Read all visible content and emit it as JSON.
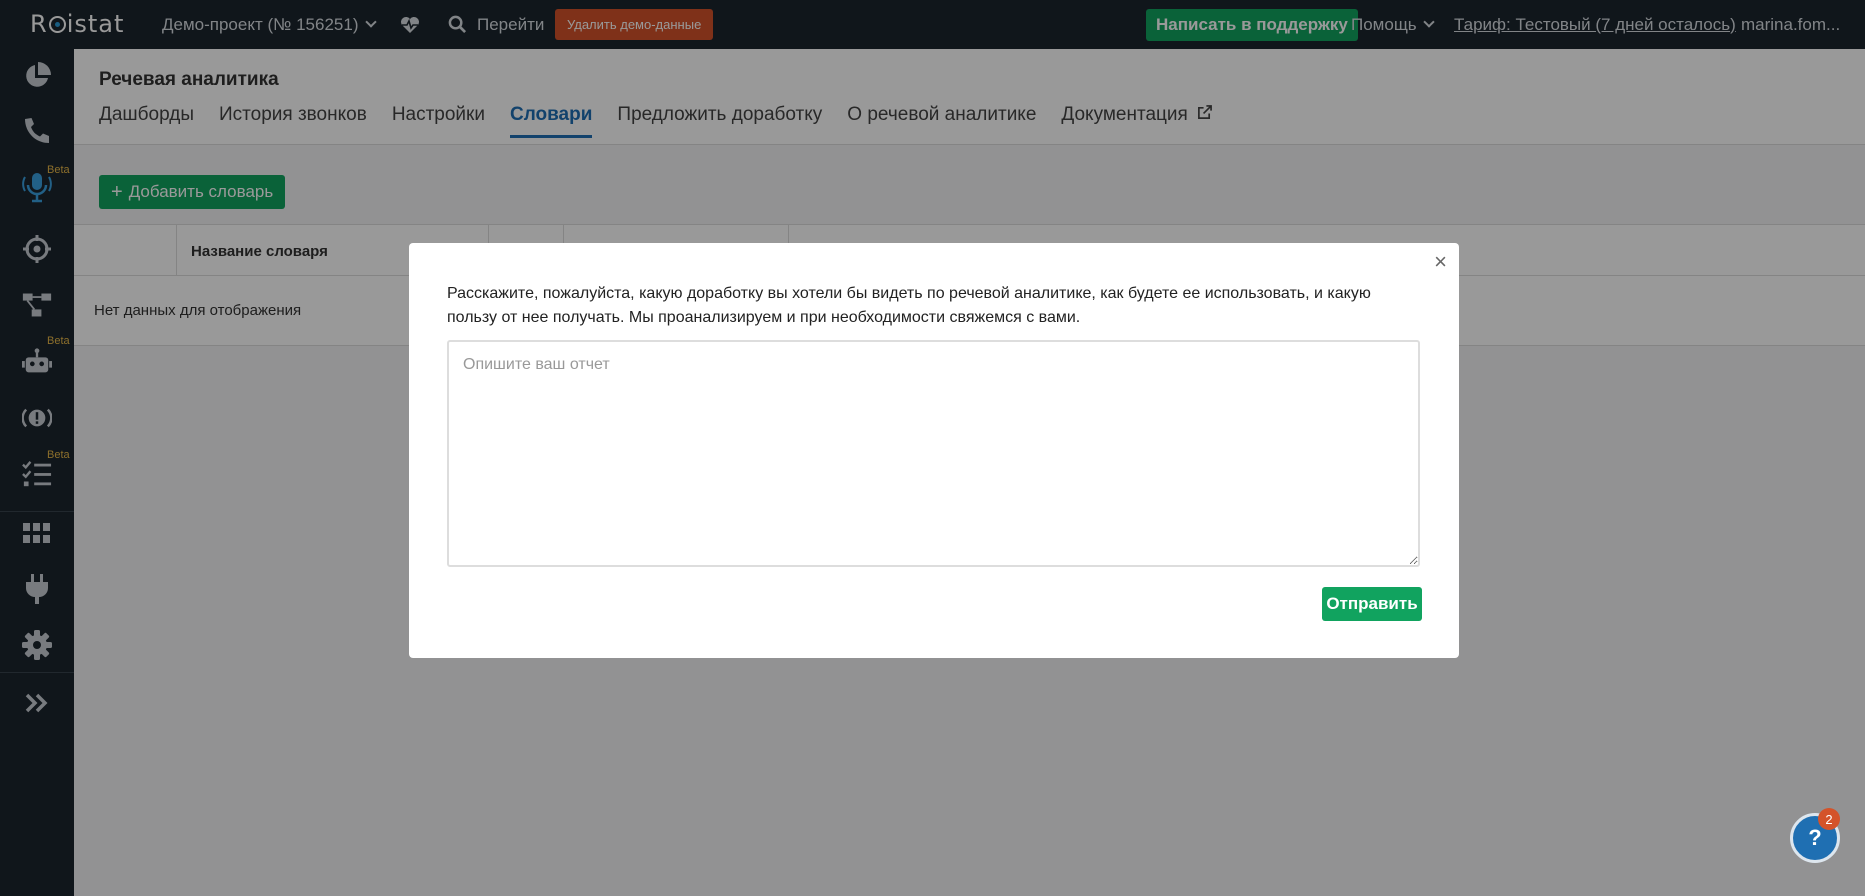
{
  "topbar": {
    "logo": "Roistat",
    "project": "Демо-проект  (№ 156251)",
    "goto": "Перейти",
    "delete_demo": "Удалить демо-данные",
    "support": "Написать в поддержку",
    "help": "Помощь",
    "tariff": "Тариф: Тестовый (7 дней осталось)",
    "user": "marina.fom..."
  },
  "sidebar": {
    "beta_label": "Beta",
    "items": [
      "pie-chart-icon",
      "phone-icon",
      "microphone-icon",
      "target-icon",
      "flow-icon",
      "robot-icon",
      "alert-icon",
      "checklist-icon",
      "apps-icon",
      "plug-icon",
      "gear-icon",
      "expand-icon"
    ]
  },
  "page": {
    "title": "Речевая аналитика",
    "tabs": [
      {
        "label": "Дашборды"
      },
      {
        "label": "История звонков"
      },
      {
        "label": "Настройки"
      },
      {
        "label": "Словари"
      },
      {
        "label": "Предложить доработку"
      },
      {
        "label": "О речевой аналитике"
      },
      {
        "label": "Документация"
      }
    ],
    "add_button": "Добавить словарь",
    "table_header_name": "Название словаря",
    "no_data": "Нет данных для отображения"
  },
  "modal": {
    "text": "Расскажите, пожалуйста, какую доработку вы хотели бы видеть по речевой аналитике, как будете ее использовать, и какую пользу от нее получать. Мы проанализируем и при необходимости свяжемся с вами.",
    "placeholder": "Опишите ваш отчет",
    "value": "",
    "submit": "Отправить"
  },
  "help_bubble": {
    "label": "?",
    "badge": "2"
  },
  "colors": {
    "accent_green": "#11a35f",
    "accent_orange": "#d4532a",
    "accent_blue": "#1e6fb5",
    "nav_bg": "#1c252e"
  }
}
